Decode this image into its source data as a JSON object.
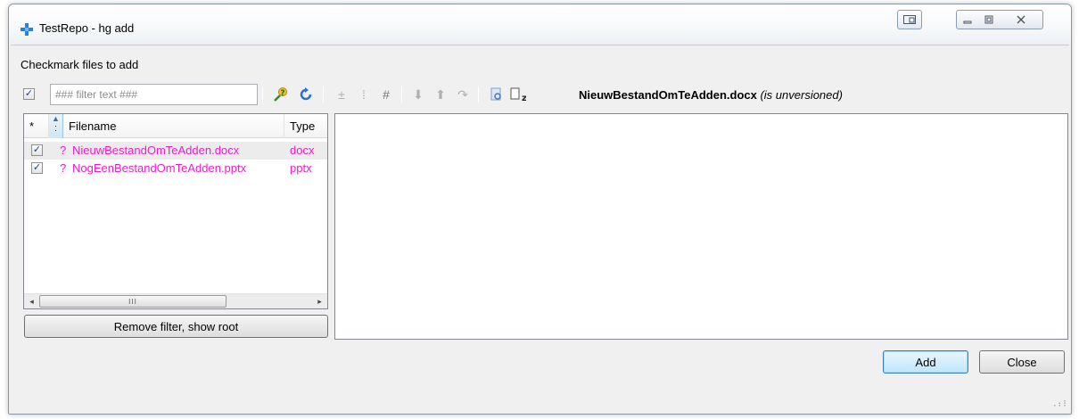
{
  "window": {
    "title": "TestRepo - hg add",
    "controls": {
      "dock": "dock",
      "minimize": "minimize",
      "maximize": "maximize",
      "close": "close"
    }
  },
  "instruction": "Checkmark files to add",
  "filter": {
    "checked": true,
    "placeholder": "### filter text ###",
    "value": ""
  },
  "toolbar": {
    "icons": [
      "settings-wand-icon",
      "refresh-icon",
      "plus-minus-icon",
      "move-up-icon",
      "hash-icon",
      "arrow-down-icon",
      "arrow-up-icon",
      "redo-icon",
      "find-icon",
      "file-z-icon"
    ],
    "glyphs": {
      "settings": "✎",
      "refresh": "⟲",
      "plusminus": "±",
      "mid": "⁞",
      "hash": "#",
      "down": "⬇",
      "up": "⬆",
      "redo": "↷",
      "find": "▣",
      "filez": "z"
    }
  },
  "current_file": {
    "name": "NieuwBestandOmTeAdden.docx",
    "status": "(is unversioned)"
  },
  "file_list": {
    "columns": {
      "star": "*",
      "status": "^",
      "filename": "Filename",
      "type": "Type"
    },
    "rows": [
      {
        "checked": true,
        "status": "?",
        "filename": "NieuwBestandOmTeAdden.docx",
        "type": "docx",
        "selected": true
      },
      {
        "checked": true,
        "status": "?",
        "filename": "NogEenBestandOmTeAdden.pptx",
        "type": "pptx",
        "selected": false
      }
    ],
    "scrollbar": {
      "left": "◂",
      "right": "▸",
      "thumb": "III"
    },
    "row_color": "#e81fc8"
  },
  "buttons": {
    "remove_filter": "Remove filter, show root",
    "add": "Add",
    "close": "Close"
  },
  "checkmark": "✓"
}
